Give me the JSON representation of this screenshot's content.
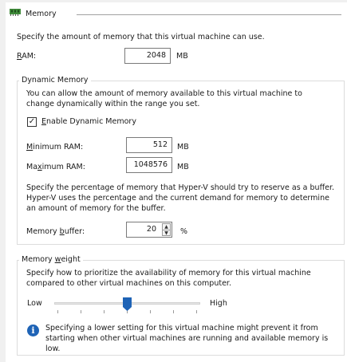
{
  "header": {
    "title": "Memory",
    "icon": "memory-chip-icon",
    "icon_color": "#3f8a3a"
  },
  "intro_text": "Specify the amount of memory that this virtual machine can use.",
  "ram": {
    "label": "RAM:",
    "value": "2048",
    "unit": "MB"
  },
  "dynamic_memory": {
    "title": "Dynamic Memory",
    "description": "You can allow the amount of memory available to this virtual machine to change dynamically within the range you set.",
    "enable_label": "Enable Dynamic Memory",
    "enabled": true,
    "minimum_ram": {
      "label": "Minimum RAM:",
      "value": "512",
      "unit": "MB"
    },
    "maximum_ram": {
      "label": "Maximum RAM:",
      "value": "1048576",
      "unit": "MB"
    },
    "buffer_description": "Specify the percentage of memory that Hyper-V should try to reserve as a buffer. Hyper-V uses the percentage and the current demand for memory to determine an amount of memory for the buffer.",
    "buffer": {
      "label": "Memory buffer:",
      "value": "20",
      "unit": "%"
    }
  },
  "memory_weight": {
    "title": "Memory weight",
    "description": "Specify how to prioritize the availability of memory for this virtual machine compared to other virtual machines on this computer.",
    "low_label": "Low",
    "high_label": "High",
    "slider_level_fraction": 0.5,
    "accent_color": "#1e63b6",
    "info_text": "Specifying a lower setting for this virtual machine might prevent it from starting when other virtual machines are running and available memory is low."
  }
}
